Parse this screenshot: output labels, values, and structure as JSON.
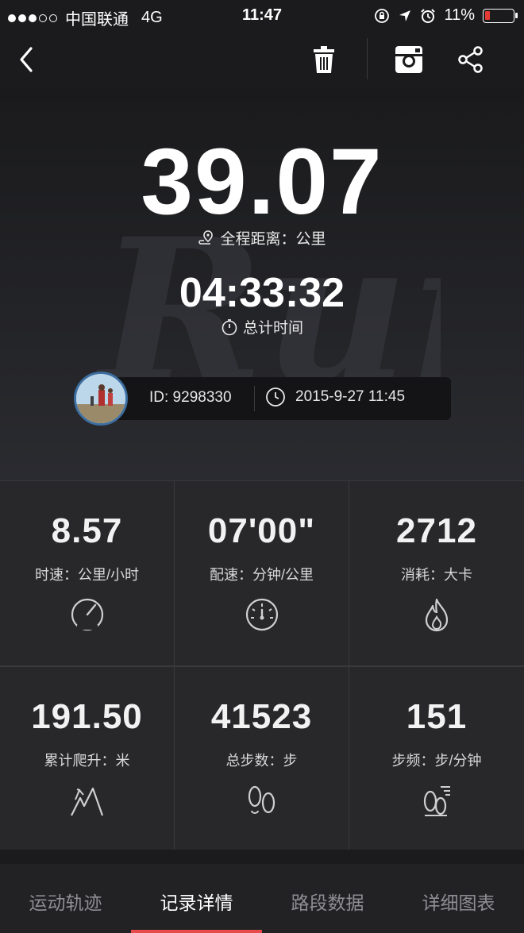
{
  "status_bar": {
    "carrier": "中国联通",
    "network": "4G",
    "time": "11:47",
    "battery_percent": "11%",
    "battery_color": "#e53935"
  },
  "toolbar": {
    "icons": [
      "back-icon",
      "trash-icon",
      "instagram-icon",
      "share-icon"
    ]
  },
  "summary": {
    "distance": "39.07",
    "distance_label": "全程距离：公里",
    "duration": "04:33:32",
    "duration_label": "总计时间",
    "watermark_text": "Run"
  },
  "meta": {
    "id_text": "ID: 9298330",
    "datetime": "2015-9-27 11:45"
  },
  "stats": [
    {
      "value": "8.57",
      "label": "时速：公里/小时",
      "icon": "speedometer-icon"
    },
    {
      "value": "07'00\"",
      "label": "配速：分钟/公里",
      "icon": "pace-gauge-icon"
    },
    {
      "value": "2712",
      "label": "消耗：大卡",
      "icon": "flame-icon"
    },
    {
      "value": "191.50",
      "label": "累计爬升：米",
      "icon": "climb-icon"
    },
    {
      "value": "41523",
      "label": "总步数：步",
      "icon": "footprints-icon"
    },
    {
      "value": "151",
      "label": "步频：步/分钟",
      "icon": "cadence-icon"
    }
  ],
  "tabs": [
    {
      "label": "运动轨迹",
      "active": false
    },
    {
      "label": "记录详情",
      "active": true
    },
    {
      "label": "路段数据",
      "active": false
    },
    {
      "label": "详细图表",
      "active": false
    }
  ],
  "accent_color": "#e84b4b"
}
